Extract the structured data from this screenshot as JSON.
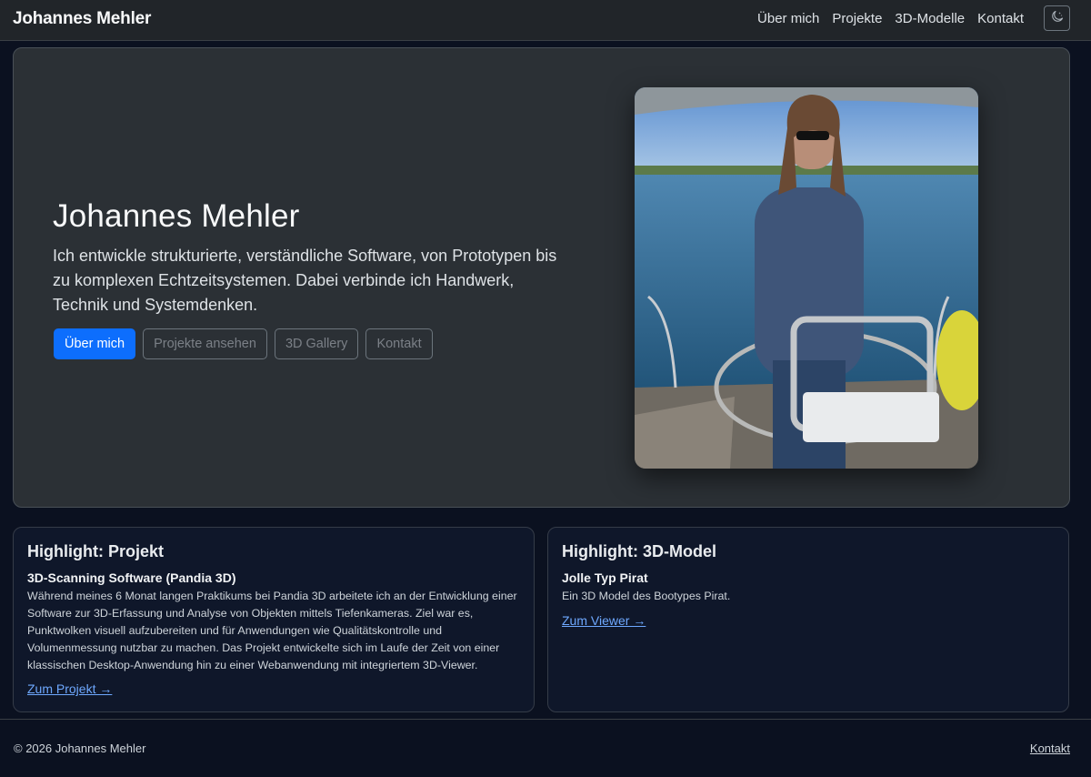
{
  "navbar": {
    "brand": "Johannes Mehler",
    "links": [
      "Über mich",
      "Projekte",
      "3D-Modelle",
      "Kontakt"
    ],
    "theme_toggle_icon": "moon-stars-icon"
  },
  "hero": {
    "title": "Johannes Mehler",
    "lead": "Ich entwickle strukturierte, verständliche Software, von Prototypen bis zu komplexen Echtzeitsystemen. Dabei verbinde ich Handwerk, Technik und Systemdenken.",
    "buttons": {
      "primary": "Über mich",
      "projects": "Projekte ansehen",
      "gallery": "3D Gallery",
      "contact": "Kontakt"
    },
    "photo_icon": "portrait-photo"
  },
  "cards": {
    "project": {
      "heading": "Highlight: Projekt",
      "subtitle": "3D-Scanning Software (Pandia 3D)",
      "text": "Während meines 6 Monat langen Praktikums bei Pandia 3D arbeitete ich an der Entwicklung einer Software zur 3D-Erfassung und Analyse von Objekten mittels Tiefenkameras. Ziel war es, Punktwolken visuell aufzubereiten und für Anwendungen wie Qualitätskontrolle und Volumenmessung nutzbar zu machen. Das Projekt entwickelte sich im Laufe der Zeit von einer klassischen Desktop-Anwendung hin zu einer Webanwendung mit integriertem 3D-Viewer.",
      "link": "Zum Projekt →"
    },
    "model": {
      "heading": "Highlight: 3D-Model",
      "subtitle": "Jolle Typ Pirat",
      "text": "Ein 3D Model des Bootypes Pirat.",
      "link": "Zum Viewer →"
    }
  },
  "footer": {
    "copyright": "© 2026 Johannes Mehler",
    "contact_link": "Kontakt"
  },
  "colors": {
    "primary": "#0d6efd",
    "link": "#6ea8fe",
    "navbar_bg": "#212529",
    "hero_bg": "#2b3035",
    "card_bg": "#0f172a",
    "page_bg": "#0b1120"
  }
}
